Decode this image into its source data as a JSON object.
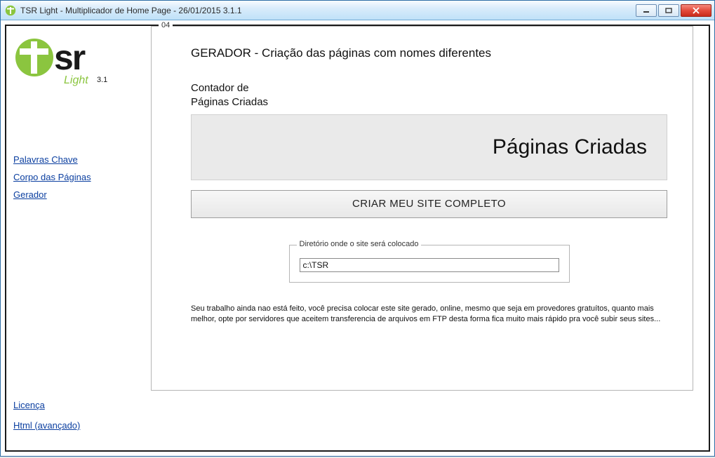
{
  "title": "TSR Light - Multiplicador de Home Page  - 26/01/2015 3.1.1",
  "logo": {
    "brand_main": "sr",
    "brand_sub": "Light",
    "brand_ver": "3.1"
  },
  "sidebar": {
    "links": [
      {
        "label": "Palavras Chave"
      },
      {
        "label": "Corpo das Páginas"
      },
      {
        "label": "Gerador"
      }
    ],
    "bottom": [
      {
        "label": "Licença"
      },
      {
        "label": "Html (avançado)"
      }
    ]
  },
  "panel": {
    "legend": "04",
    "heading": "GERADOR - Criação das páginas com nomes diferentes",
    "counter_label_line1": "Contador de",
    "counter_label_line2": "Páginas Criadas",
    "big_box_text": "Páginas Criadas",
    "create_button": "CRIAR MEU SITE COMPLETO",
    "dir_legend": "Diretório onde o site será colocado",
    "dir_value": "c:\\TSR",
    "note": "Seu trabalho ainda nao está feito, você precisa colocar este site gerado, online, mesmo que seja em provedores gratuítos, quanto mais melhor, opte por servidores que aceitem transferencia de arquivos em FTP desta forma fica muito mais rápido pra você subir seus sites..."
  }
}
